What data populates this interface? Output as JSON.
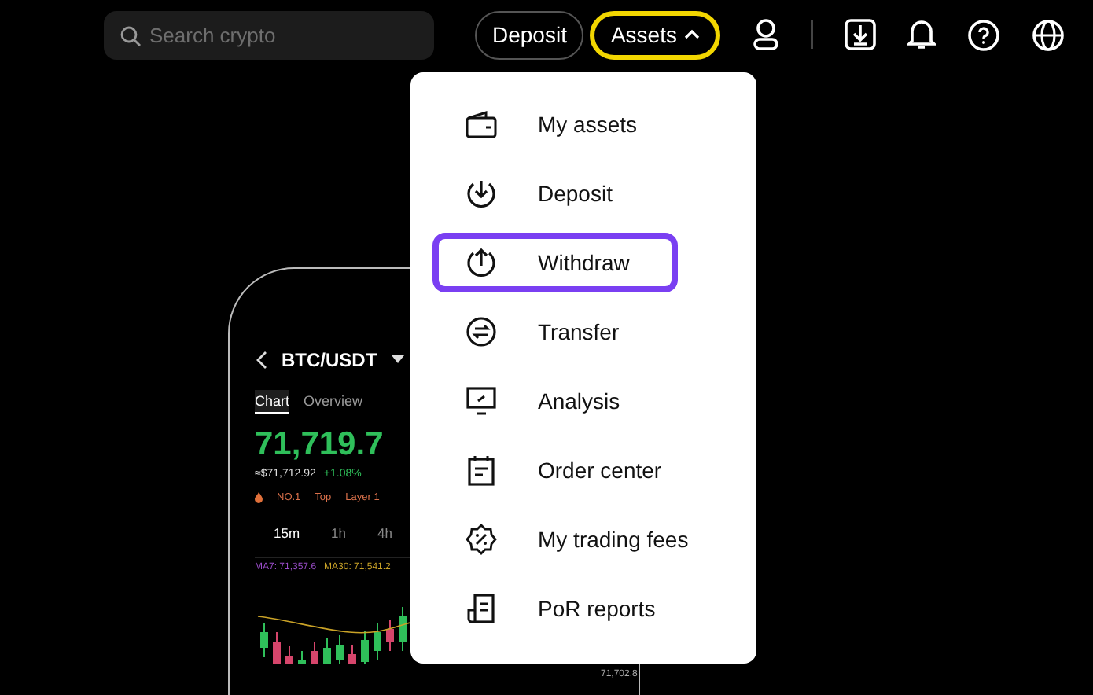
{
  "header": {
    "search": {
      "placeholder": "Search crypto"
    },
    "buttons": [
      {
        "label": "Deposit",
        "kind": "outline",
        "highlighted": false
      },
      {
        "label": "Assets",
        "kind": "dropdown",
        "highlighted": true,
        "expanded": true
      }
    ],
    "icons": [
      {
        "kind": "user"
      },
      {
        "kind": "divider"
      },
      {
        "kind": "download"
      },
      {
        "kind": "bell"
      },
      {
        "kind": "help"
      },
      {
        "kind": "globe"
      }
    ]
  },
  "phone": {
    "pair": "BTC/USDT",
    "tabs": [
      {
        "label": "Chart",
        "selected": true
      },
      {
        "label": "Overview",
        "selected": false
      }
    ],
    "price": "71,719.7",
    "fiat": "≈$71,712.92",
    "change": "+1.08%",
    "tags": [
      "NO.1",
      "Top",
      "Layer 1"
    ],
    "intervals": [
      {
        "label": "15m",
        "selected": true
      },
      {
        "label": "1h",
        "selected": false
      },
      {
        "label": "4h",
        "selected": false
      }
    ],
    "ma": [
      {
        "label": "MA7: 71,357.6",
        "color": "#9b4dca"
      },
      {
        "label": "MA30: 71,541.2",
        "color": "#c9a227"
      }
    ],
    "axis_label": "71,702.8"
  },
  "menu": {
    "items": [
      {
        "label": "My assets",
        "kind": "wallet",
        "highlighted": false
      },
      {
        "label": "Deposit",
        "kind": "deposit",
        "highlighted": false
      },
      {
        "label": "Withdraw",
        "kind": "withdraw",
        "highlighted": true
      },
      {
        "label": "Transfer",
        "kind": "transfer",
        "highlighted": false
      },
      {
        "label": "Analysis",
        "kind": "analysis",
        "highlighted": false
      },
      {
        "label": "Order center",
        "kind": "order",
        "highlighted": false
      },
      {
        "label": "My trading fees",
        "kind": "fees",
        "highlighted": false
      },
      {
        "label": "PoR reports",
        "kind": "report",
        "highlighted": false
      }
    ]
  }
}
